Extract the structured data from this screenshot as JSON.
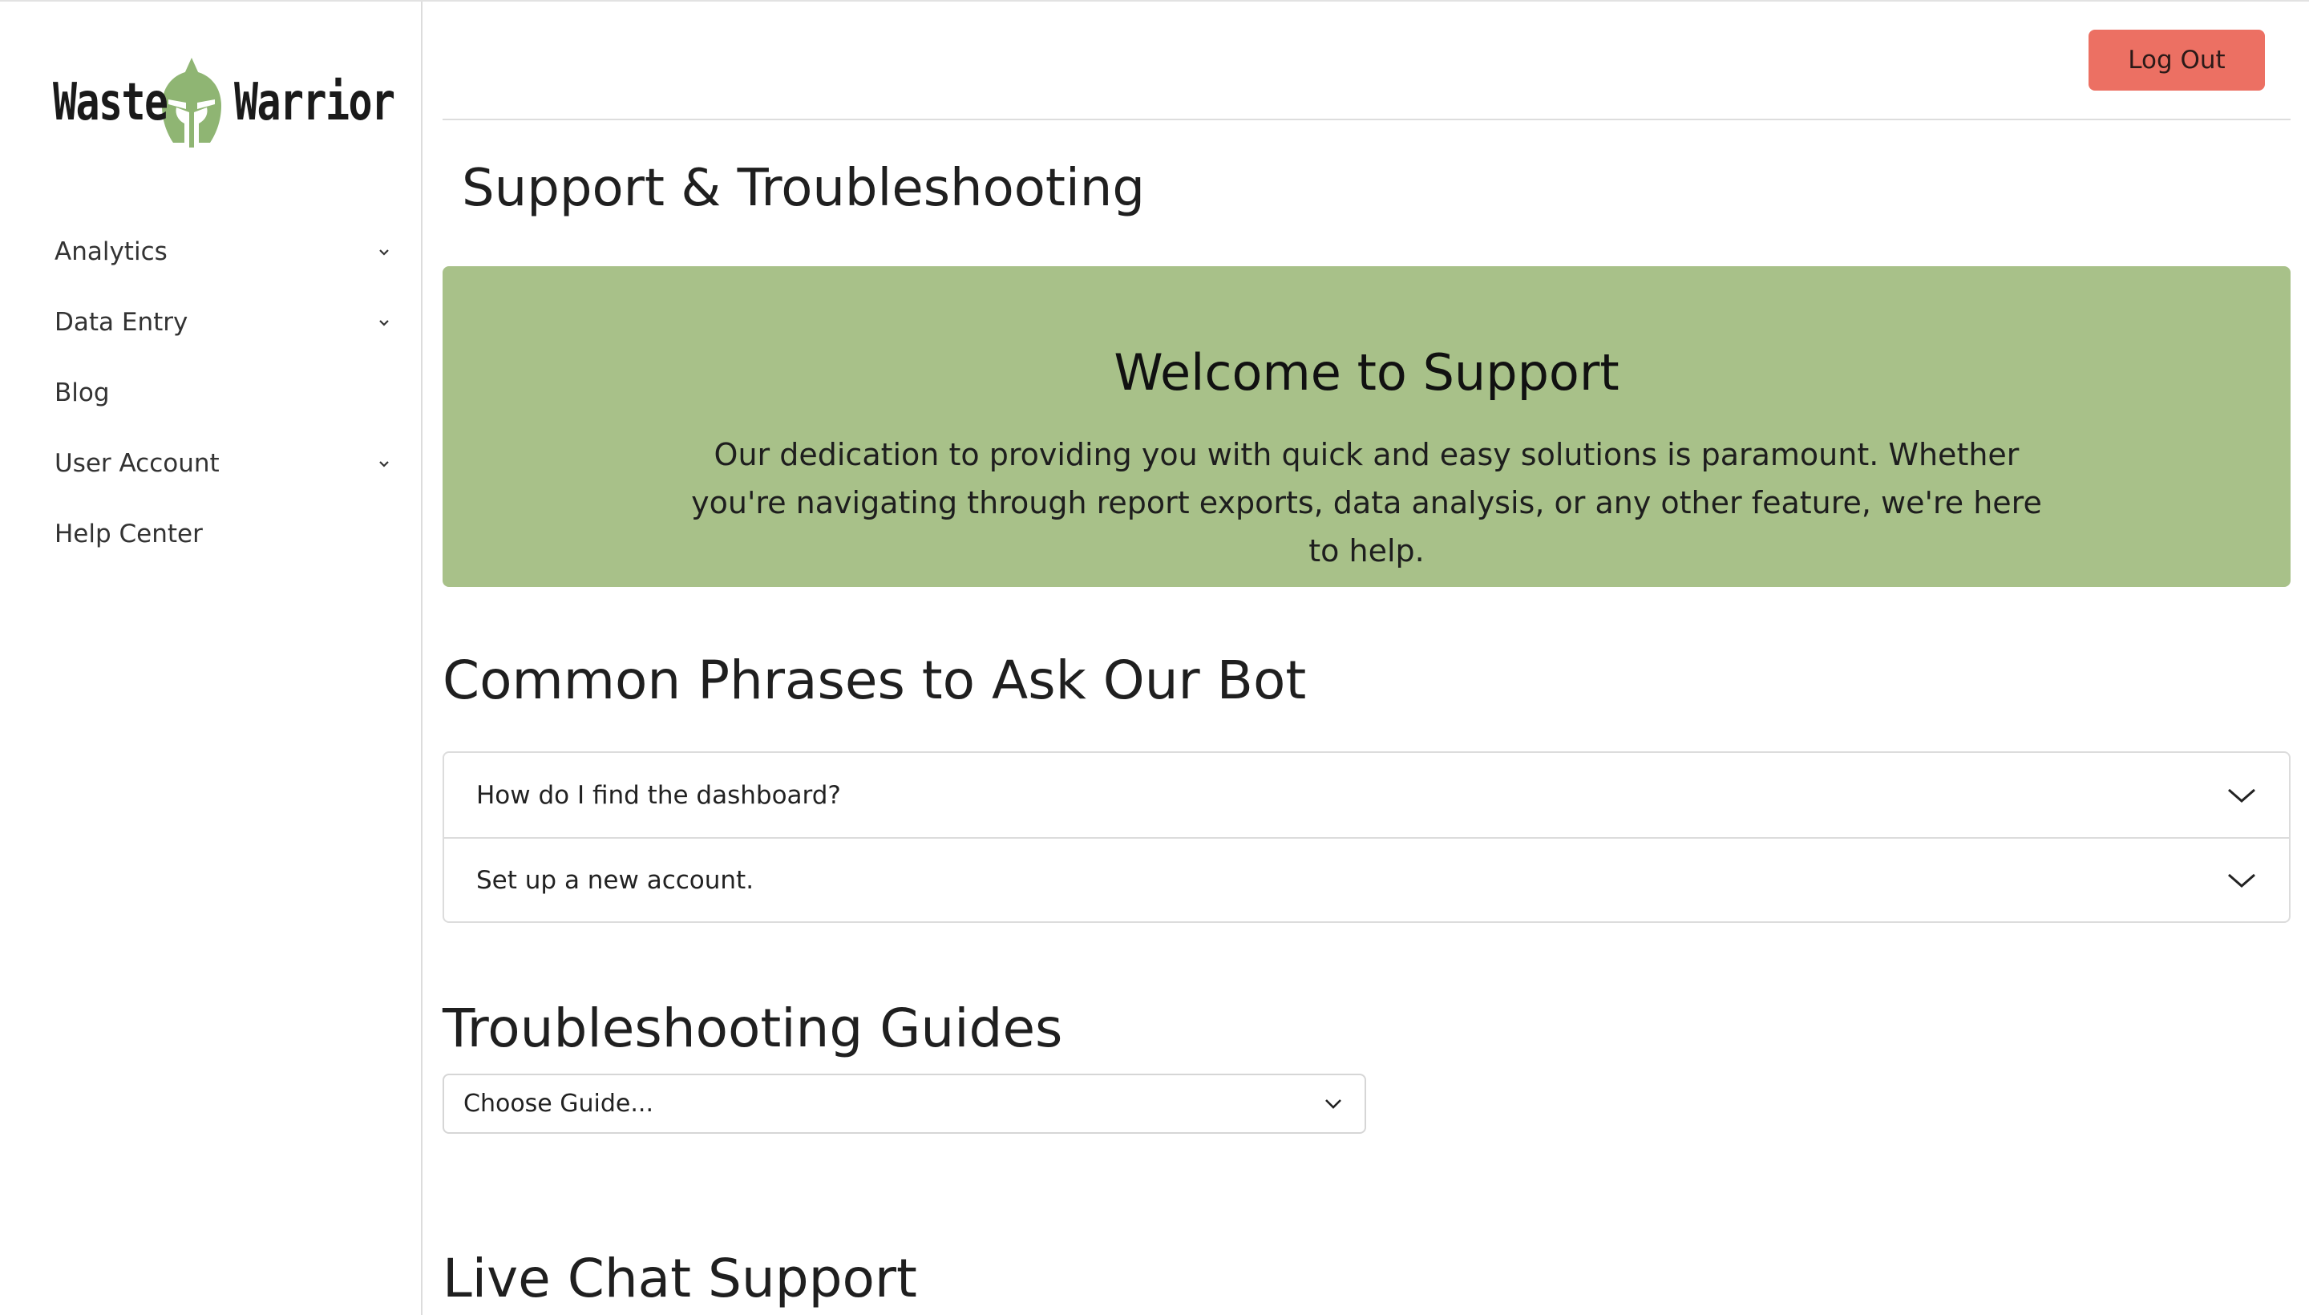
{
  "brand": {
    "word1": "Waste",
    "word2": "Warrior",
    "helmet_color": "#8fb573"
  },
  "sidebar": {
    "items": [
      {
        "label": "Analytics",
        "has_submenu": true
      },
      {
        "label": "Data Entry",
        "has_submenu": true
      },
      {
        "label": "Blog",
        "has_submenu": false
      },
      {
        "label": "User Account",
        "has_submenu": true
      },
      {
        "label": "Help Center",
        "has_submenu": false
      }
    ]
  },
  "header": {
    "logout_label": "Log Out",
    "logout_color": "#ec7063"
  },
  "page": {
    "title": "Support & Troubleshooting"
  },
  "welcome": {
    "title": "Welcome to Support",
    "body": "Our dedication to providing you with quick and easy solutions is paramount. Whether you're navigating through report exports, data analysis, or any other feature, we're here to help.",
    "background": "#a8c189"
  },
  "phrases": {
    "heading": "Common Phrases to Ask Our Bot",
    "items": [
      {
        "label": "How do I find the dashboard?"
      },
      {
        "label": "Set up a new account."
      }
    ]
  },
  "guides": {
    "heading": "Troubleshooting Guides",
    "select_value": "Choose Guide..."
  },
  "live_chat": {
    "heading": "Live Chat Support"
  }
}
